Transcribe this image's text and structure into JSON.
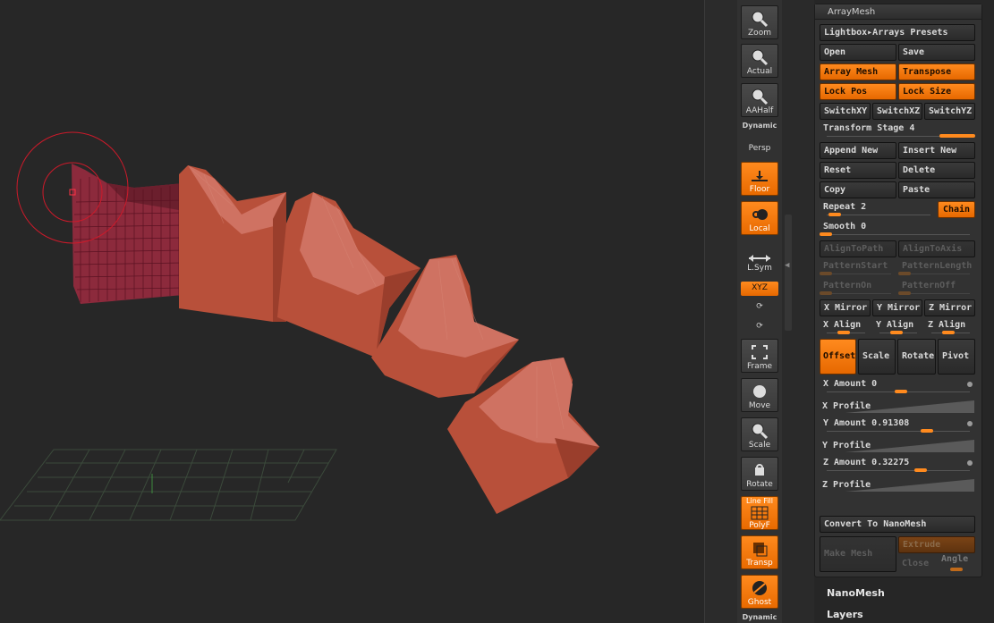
{
  "shelf": {
    "zoom": "Zoom",
    "actual": "Actual",
    "aahalf": "AAHalf",
    "dynamic_top": "Dynamic",
    "persp": "Persp",
    "floor": "Floor",
    "floor_axis": "Y",
    "local": "Local",
    "lsym": "L.Sym",
    "xyz": "XYZ",
    "frame": "Frame",
    "move": "Move",
    "scale": "Scale",
    "rotate": "Rotate",
    "linefill": "Line Fill",
    "polyf": "PolyF",
    "transp": "Transp",
    "ghost": "Ghost",
    "dynamic_bottom": "Dynamic"
  },
  "panel": {
    "title": "ArrayMesh",
    "lightbox": "Lightbox▸Arrays Presets",
    "open": "Open",
    "save": "Save",
    "array_mesh": "Array Mesh",
    "transpose": "Transpose",
    "lock_pos": "Lock Pos",
    "lock_size": "Lock Size",
    "switch_xy": "SwitchXY",
    "switch_xz": "SwitchXZ",
    "switch_yz": "SwitchYZ",
    "transform_stage": "Transform Stage 4",
    "append_new": "Append New",
    "insert_new": "Insert New",
    "reset": "Reset",
    "delete": "Delete",
    "copy": "Copy",
    "paste": "Paste",
    "repeat": "Repeat 2",
    "chain": "Chain",
    "smooth": "Smooth 0",
    "align_to_path": "AlignToPath",
    "align_to_axis": "AlignToAxis",
    "pattern_start": "PatternStart",
    "pattern_length": "PatternLength",
    "pattern_on": "PatternOn",
    "pattern_off": "PatternOff",
    "x_mirror": "X Mirror",
    "y_mirror": "Y Mirror",
    "z_mirror": "Z Mirror",
    "x_align": "X Align",
    "y_align": "Y Align",
    "z_align": "Z Align",
    "offset": "Offset",
    "scale": "Scale",
    "rotate": "Rotate",
    "pivot": "Pivot",
    "x_amount": "X Amount 0",
    "x_profile": "X Profile",
    "y_amount": "Y Amount 0.91308",
    "y_profile": "Y Profile",
    "z_amount": "Z Amount 0.32275",
    "z_profile": "Z Profile",
    "convert_nanomesh": "Convert To NanoMesh",
    "make_mesh": "Make Mesh",
    "extrude": "Extrude",
    "close": "Close",
    "angle": "Angle"
  },
  "subpalettes": {
    "nanomesh": "NanoMesh",
    "layers": "Layers"
  },
  "colors": {
    "accent": "#ff8a1e",
    "mesh": "#b8503a",
    "selected_mesh": "#8c2a3c",
    "cursor": "#cc1a2a"
  }
}
